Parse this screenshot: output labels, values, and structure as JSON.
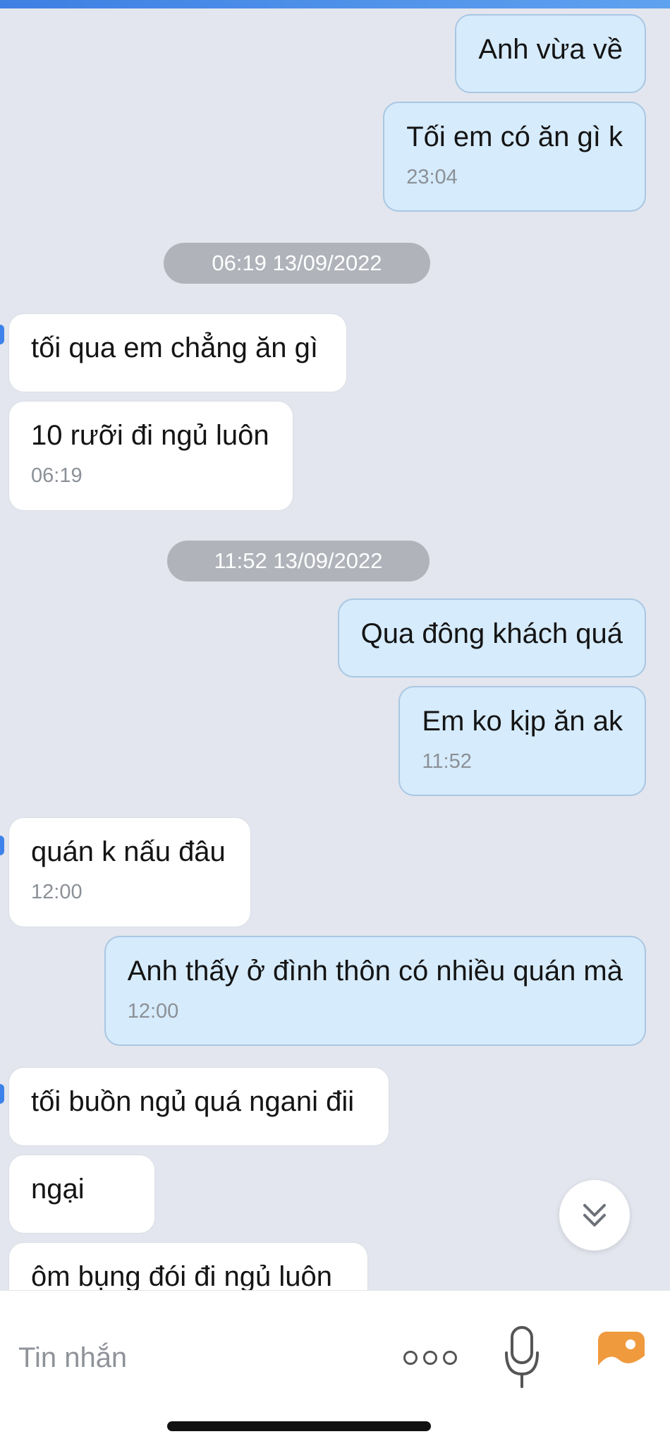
{
  "messages": [
    {
      "dir": "out",
      "text": "Anh vừa về"
    },
    {
      "dir": "out",
      "text": "Tối em có ăn gì k",
      "time": "23:04"
    },
    {
      "separator": "06:19 13/09/2022"
    },
    {
      "dir": "in",
      "text": "tối qua em chẳng ăn gì"
    },
    {
      "dir": "in",
      "text": "10 rưỡi đi ngủ luôn",
      "time": "06:19"
    },
    {
      "separator": "11:52 13/09/2022"
    },
    {
      "dir": "out",
      "text": "Qua đông khách quá"
    },
    {
      "dir": "out",
      "text": "Em ko kịp ăn ak",
      "time": "11:52"
    },
    {
      "dir": "in",
      "text": "quán k nấu đâu",
      "time": "12:00"
    },
    {
      "dir": "out",
      "text": "Anh thấy ở đình thôn có nhiều quán mà",
      "time": "12:00"
    },
    {
      "dir": "in",
      "text": "tối buồn ngủ quá ngani đii"
    },
    {
      "dir": "in",
      "text": "ngại"
    },
    {
      "dir": "in",
      "text": "ôm bụng đói đi ngủ luôn"
    }
  ],
  "input": {
    "placeholder": "Tin nhắn"
  },
  "icons": {
    "scroll_down": "double-chevron-down-icon",
    "more": "more-options-icon",
    "mic": "microphone-icon",
    "photo": "photo-icon"
  },
  "colors": {
    "outgoing_bubble": "#d6ebfb",
    "incoming_bubble": "#ffffff",
    "background": "#e3e6ee",
    "photo_icon": "#f09a3e"
  }
}
